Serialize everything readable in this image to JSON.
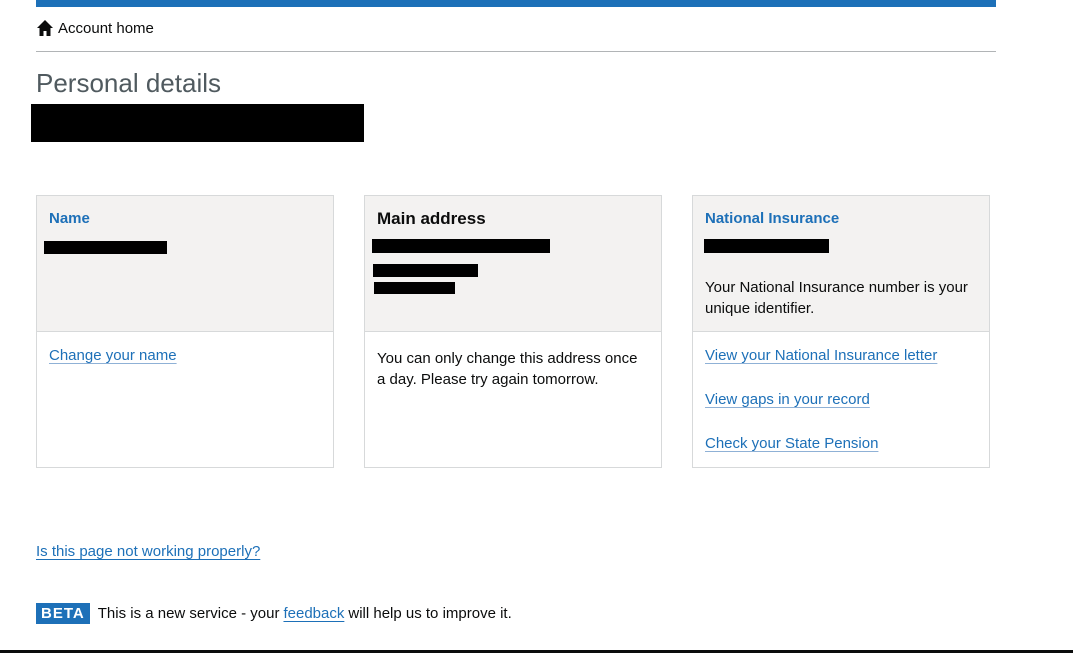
{
  "breadcrumb": {
    "home_label": "Account home"
  },
  "page": {
    "title": "Personal details"
  },
  "cards": {
    "name": {
      "heading": "Name",
      "action": "Change your name"
    },
    "address": {
      "heading": "Main address",
      "notice": "You can only change this address once a day. Please try again tomorrow."
    },
    "ni": {
      "heading": "National Insurance",
      "description": "Your National Insurance number is your unique identifier.",
      "actions": [
        "View your National Insurance letter",
        "View gaps in your record",
        "Check your State Pension"
      ]
    }
  },
  "footer": {
    "problem_link": "Is this page not working properly?",
    "beta_tag": "BETA",
    "beta_text_before": "This is a new service - your",
    "beta_link": "feedback",
    "beta_text_after": "will help us to improve it."
  },
  "colors": {
    "brand_blue": "#1d70b8",
    "text": "#0b0c0c",
    "panel_bg": "#f3f2f1"
  }
}
